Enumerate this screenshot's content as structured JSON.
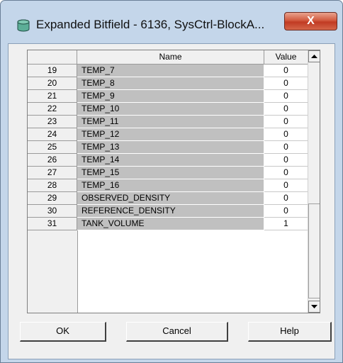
{
  "window": {
    "title": "Expanded Bitfield - 6136, SysCtrl-BlockA...",
    "close_label": "X"
  },
  "table": {
    "headers": {
      "index": "",
      "name": "Name",
      "value": "Value"
    },
    "rows": [
      {
        "index": "19",
        "name": "TEMP_7",
        "value": "0"
      },
      {
        "index": "20",
        "name": "TEMP_8",
        "value": "0"
      },
      {
        "index": "21",
        "name": "TEMP_9",
        "value": "0"
      },
      {
        "index": "22",
        "name": "TEMP_10",
        "value": "0"
      },
      {
        "index": "23",
        "name": "TEMP_11",
        "value": "0"
      },
      {
        "index": "24",
        "name": "TEMP_12",
        "value": "0"
      },
      {
        "index": "25",
        "name": "TEMP_13",
        "value": "0"
      },
      {
        "index": "26",
        "name": "TEMP_14",
        "value": "0"
      },
      {
        "index": "27",
        "name": "TEMP_15",
        "value": "0"
      },
      {
        "index": "28",
        "name": "TEMP_16",
        "value": "0"
      },
      {
        "index": "29",
        "name": "OBSERVED_DENSITY",
        "value": "0"
      },
      {
        "index": "30",
        "name": "REFERENCE_DENSITY",
        "value": "0"
      },
      {
        "index": "31",
        "name": "TANK_VOLUME",
        "value": "1"
      }
    ]
  },
  "buttons": {
    "ok": "OK",
    "cancel": "Cancel",
    "help": "Help"
  },
  "icons": {
    "app": "database-icon",
    "scroll_up": "arrow-up-icon",
    "scroll_down": "arrow-down-icon"
  }
}
